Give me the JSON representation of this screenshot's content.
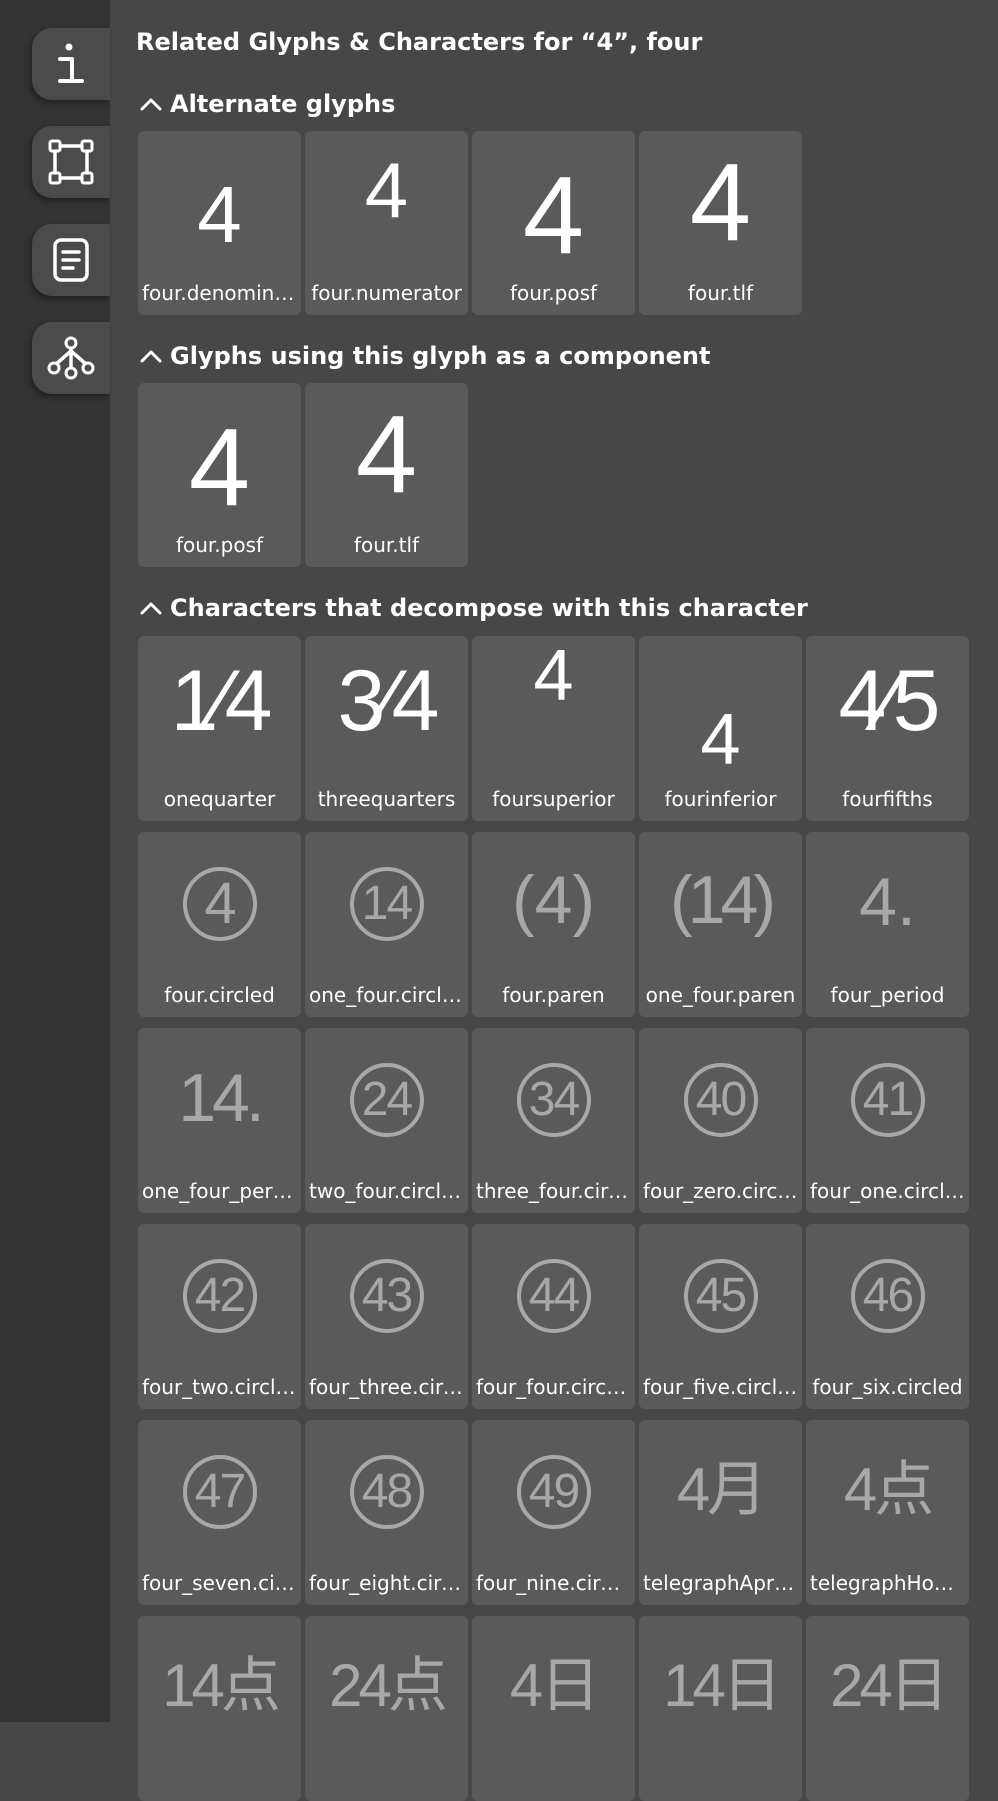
{
  "panel_title": "Related Glyphs & Characters for “4”, four",
  "sections": {
    "alternate": {
      "title": "Alternate glyphs",
      "items": [
        {
          "glyph": "4",
          "name": "four.denomina..."
        },
        {
          "glyph": "4",
          "name": "four.numerator"
        },
        {
          "glyph": "4",
          "name": "four.posf"
        },
        {
          "glyph": "4",
          "name": "four.tlf"
        }
      ]
    },
    "component": {
      "title": "Glyphs using this glyph as a component",
      "items": [
        {
          "glyph": "4",
          "name": "four.posf"
        },
        {
          "glyph": "4",
          "name": "four.tlf"
        }
      ]
    },
    "decompose": {
      "title": "Characters that decompose with this character",
      "items": [
        {
          "glyph": "1⁄4",
          "name": "onequarter"
        },
        {
          "glyph": "3⁄4",
          "name": "threequarters"
        },
        {
          "glyph": "4",
          "name": "foursuperior"
        },
        {
          "glyph": "4",
          "name": "fourinferior"
        },
        {
          "glyph": "4⁄5",
          "name": "fourfifths"
        },
        {
          "glyph": "4",
          "name": "four.circled"
        },
        {
          "glyph": "14",
          "name": "one_four.circled"
        },
        {
          "glyph": "(4)",
          "name": "four.paren"
        },
        {
          "glyph": "(14)",
          "name": "one_four.paren"
        },
        {
          "glyph": "4.",
          "name": "four_period"
        },
        {
          "glyph": "14.",
          "name": "one_four_period"
        },
        {
          "glyph": "24",
          "name": "two_four.circled"
        },
        {
          "glyph": "34",
          "name": "three_four.circ..."
        },
        {
          "glyph": "40",
          "name": "four_zero.circl..."
        },
        {
          "glyph": "41",
          "name": "four_one.circled"
        },
        {
          "glyph": "42",
          "name": "four_two.circled"
        },
        {
          "glyph": "43",
          "name": "four_three.circ..."
        },
        {
          "glyph": "44",
          "name": "four_four.circled"
        },
        {
          "glyph": "45",
          "name": "four_five.circled"
        },
        {
          "glyph": "46",
          "name": "four_six.circled"
        },
        {
          "glyph": "47",
          "name": "four_seven.circ..."
        },
        {
          "glyph": "48",
          "name": "four_eight.circl..."
        },
        {
          "glyph": "49",
          "name": "four_nine.circl..."
        },
        {
          "glyph": "4月",
          "name": "telegraphApril..."
        },
        {
          "glyph": "4点",
          "name": "telegraphHour..."
        },
        {
          "glyph": "14点",
          "name": ""
        },
        {
          "glyph": "24点",
          "name": ""
        },
        {
          "glyph": "4日",
          "name": ""
        },
        {
          "glyph": "14日",
          "name": ""
        },
        {
          "glyph": "24日",
          "name": ""
        }
      ]
    }
  },
  "sidebar_icons": [
    "info-icon",
    "bounding-box-icon",
    "document-icon",
    "component-tree-icon"
  ],
  "colors": {
    "sidebar": "#333333",
    "panel": "#474747",
    "card": "#5a5a5a",
    "dim_glyph": "#a8a8a8"
  }
}
